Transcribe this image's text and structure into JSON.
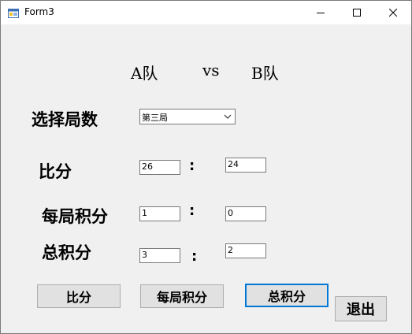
{
  "window": {
    "title": "Form3"
  },
  "header": {
    "team_a": "A队",
    "vs": "vs",
    "team_b": "B队"
  },
  "round_select": {
    "label": "选择局数",
    "value": "第三局"
  },
  "score": {
    "label": "比分",
    "a": "26",
    "separator": ":",
    "b": "24"
  },
  "round_points": {
    "label": "每局积分",
    "a": "1",
    "separator": ":",
    "b": "0"
  },
  "total_points": {
    "label": "总积分",
    "a": "3",
    "separator": ":",
    "b": "2"
  },
  "buttons": {
    "score": "比分",
    "round_points": "每局积分",
    "total_points": "总积分",
    "exit": "退出"
  },
  "colors": {
    "focus_border": "#0078d7",
    "button_face": "#e1e1e1",
    "window_bg": "#f0f0f0"
  }
}
